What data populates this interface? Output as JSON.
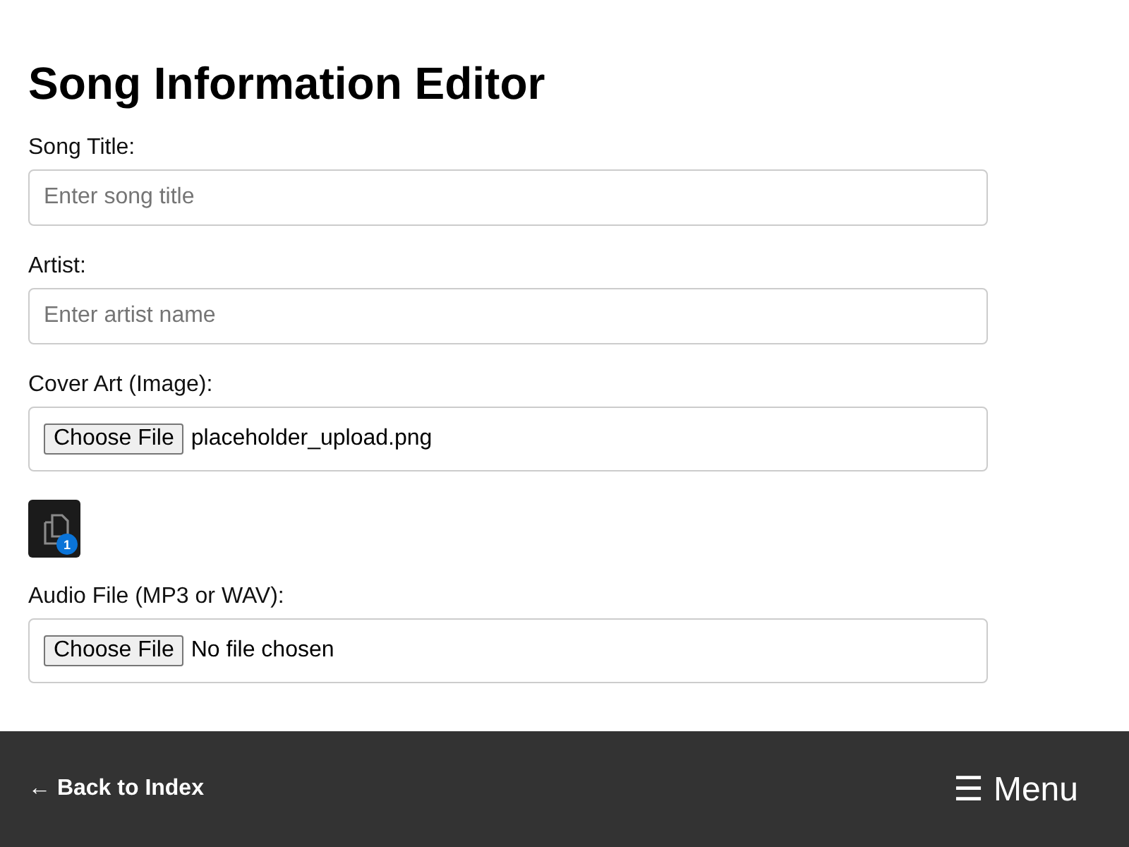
{
  "title": "Song Information Editor",
  "fields": [
    {
      "kind": "text",
      "label": "Song Title:",
      "placeholder": "Enter song title"
    },
    {
      "kind": "text",
      "label": "Artist:",
      "placeholder": "Enter artist name"
    },
    {
      "kind": "file",
      "label": "Cover Art (Image):",
      "button": "Choose File",
      "value": "placeholder_upload.png",
      "preview_badge": "1"
    },
    {
      "kind": "file",
      "label": "Audio File (MP3 or WAV):",
      "button": "Choose File",
      "value": "No file chosen"
    }
  ],
  "footer": {
    "back_link": "← Back to Index",
    "menu": "☰ Menu"
  }
}
